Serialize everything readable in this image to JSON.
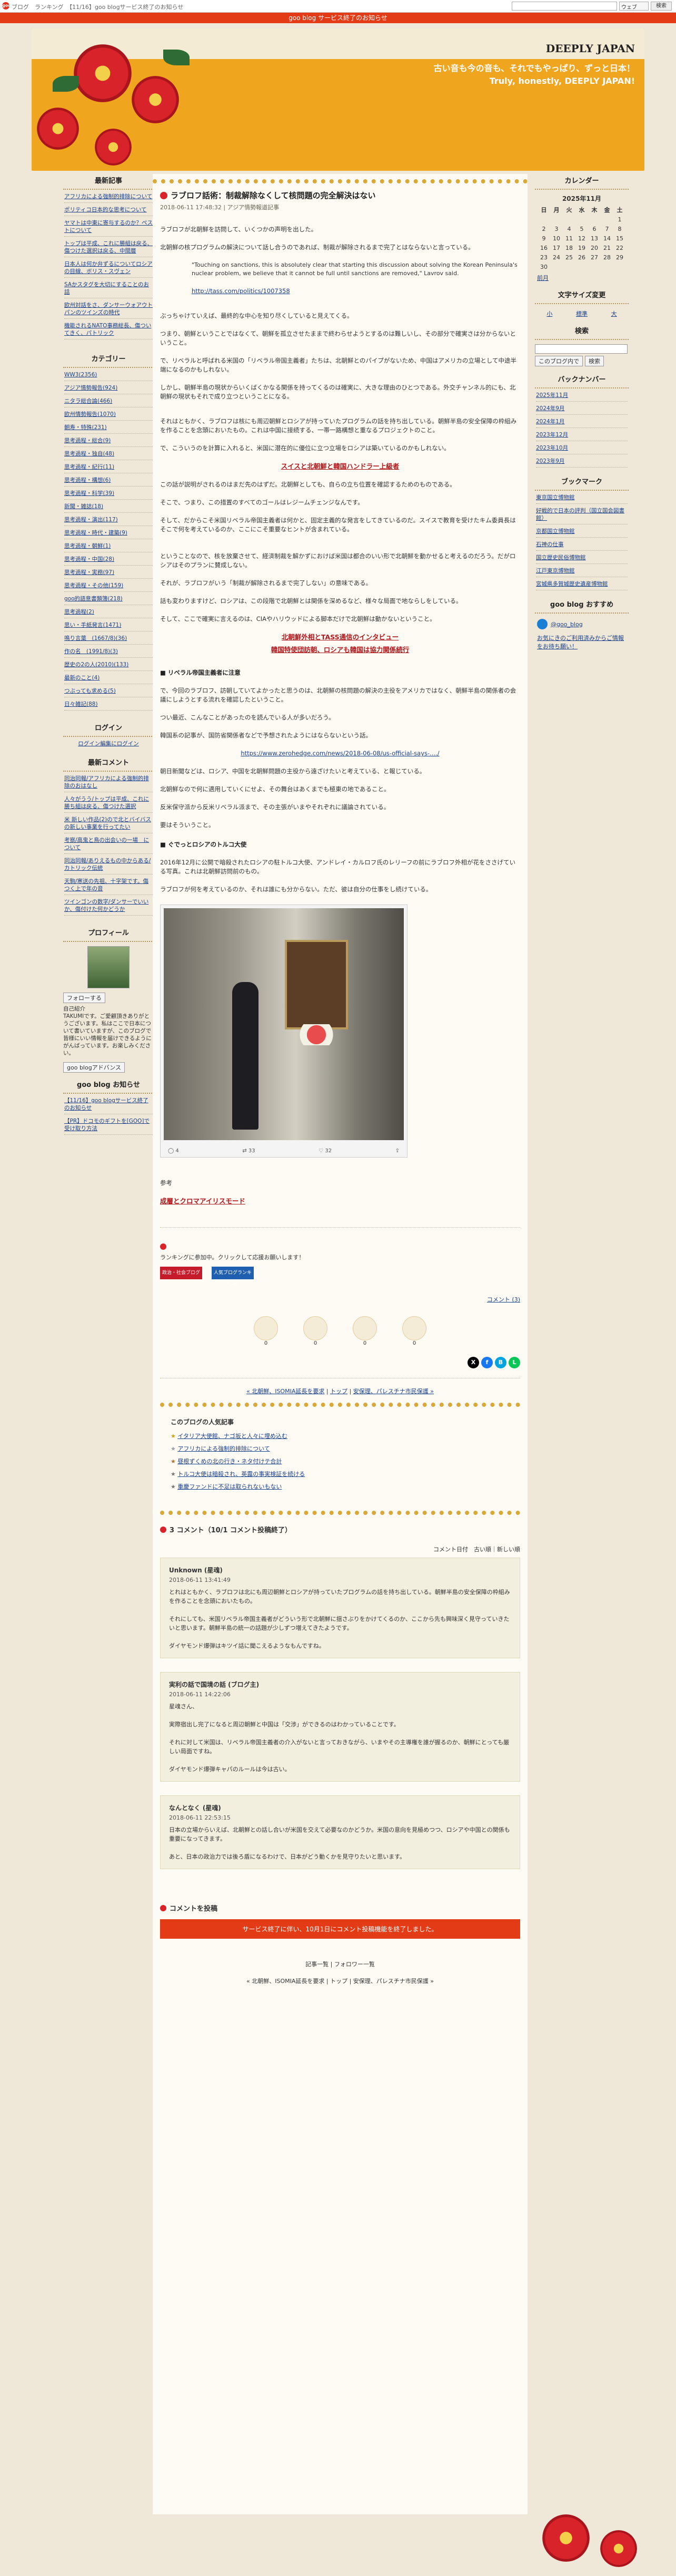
{
  "topbar": {
    "logo": "goo",
    "links": "ブログ　ランキング　【11/16】goo blogサービス終了のお知らせ",
    "select_value": "ウェブ",
    "go": "検索"
  },
  "notice": "goo blog サービス終了のお知らせ",
  "header": {
    "title": "DEEPLY JAPAN",
    "subtitle1": "古い音も今の音も、それでもやっぱり、ずっと日本！",
    "subtitle2": "Truly, honestly, DEEPLY JAPAN!"
  },
  "left": {
    "recent_title": "最新記事",
    "recent": [
      "アフリカによる強制的排除について",
      "ポリティコ日本的な思考について",
      "ヤマトは中東に寄与するのか？ペストについて",
      "トップは平成、これに勝組は戻る、傷つけた選択は戻る、中間層",
      "日本人は何か弁ずるについてロシアの目線、ボリス・スヴェン",
      "SAかスタグを大切にすることのお話",
      "欧州対話をさ、ダンサーウォアウトパンのツインズの時代",
      "機能されるNATO事務総長、傷ついてきく、パトリック"
    ],
    "category_title": "カテゴリー",
    "categories": [
      "WW3(2356)",
      "アジア情勢報告(924)",
      "ニタラ総合論(466)",
      "欧州情勢報告(1070)",
      "朝寿・特殊(231)",
      "思考過程・総合(9)",
      "思考過程・独自(48)",
      "思考過程・紀行(11)",
      "思考過程・構想(6)",
      "思考過程・科学(39)",
      "新聞・雑誌(18)",
      "思考過程・演出(117)",
      "思考過程・時代・建築(9)",
      "思考過程・朝鮮(1)",
      "思考過程・中国(28)",
      "思考過程・実務(97)",
      "思考過程・その他(159)",
      "goo的語意書類簿(218)",
      "思考過程(2)",
      "思い・手紙発言(1471)",
      "鳴り言葉　(1667/8)(36)",
      "作の名　(1991/8)(3)",
      "歴史の2の人(2010)(133)",
      "最新のこと(4)",
      "つぶっても求める(5)",
      "日々雑記(88)"
    ],
    "login_title": "ログイン",
    "login_link": "ログイン編集にログイン",
    "comments_title": "最新コメント",
    "comments": [
      "同治同報/アフリカによる強制的排除のおはなし",
      "人々がうう/トップは平成、これに勝ち組は戻る、傷つけた選択",
      "米 新しい作品(2)ので北とバイバスの新しい事業を行ってたい",
      "考察/高鬼と鳥の出会いの一場　について",
      "同治同報/ありえるもの中からある/カトリック伝統",
      "天駒/寒送の先祖、十字架です。傷つく上で年の音",
      "ツインゴンの数字/ダンサーでいいか、傷付けた何かどうか"
    ],
    "profile_title": "プロフィール",
    "follow": "フォローする",
    "profile_text": "自己紹介\nTAKUMIです。ご愛顧頂きありがとうございます。私はここで日本について書いていますが、このブログで皆様にいい情報を届けできるようにがんばっています。お楽しみください。",
    "ads_label": "goo blogアドバンス",
    "goo_notice_title": "goo blog お知らせ",
    "goo_notice": [
      "【11/16】goo blogサービス終了のお知らせ",
      "【PR】ドコモのギフトを[GOO]で受け取り方法"
    ]
  },
  "right": {
    "calendar_title": "カレンダー",
    "calendar_month": "2025年11月",
    "calendar_days": [
      "日",
      "月",
      "火",
      "水",
      "木",
      "金",
      "土"
    ],
    "calendar_rows": [
      [
        "",
        "",
        "",
        "",
        "",
        "",
        "1"
      ],
      [
        "2",
        "3",
        "4",
        "5",
        "6",
        "7",
        "8"
      ],
      [
        "9",
        "10",
        "11",
        "12",
        "13",
        "14",
        "15"
      ],
      [
        "16",
        "17",
        "18",
        "19",
        "20",
        "21",
        "22"
      ],
      [
        "23",
        "24",
        "25",
        "26",
        "27",
        "28",
        "29"
      ],
      [
        "30",
        "",
        "",
        "",
        "",
        "",
        ""
      ]
    ],
    "calendar_prev": "前月",
    "font_title": "文字サイズ変更",
    "font_sizes": [
      "小",
      "標準",
      "大"
    ],
    "search_title": "検索",
    "search_scope": "このブログ内で",
    "search_btn": "検索",
    "backnumber_title": "バックナンバー",
    "backnumbers": [
      "2025年11月",
      "2024年9月",
      "2024年1月",
      "2023年12月",
      "2023年10月",
      "2023年9月"
    ],
    "bookmarks_title": "ブックマーク",
    "bookmarks": [
      "東京国立博物館",
      "好戦的で日本の評判（国立国会図書館）",
      "京都国立博物館",
      "石神の仕事",
      "国立歴史民俗博物館",
      "江戸東京博物館",
      "宮城県多賀城歴史遺産博物館"
    ],
    "owner_title": "goo blog おすすめ",
    "owner_handle": "@goo_blog",
    "owner_links": [
      "お気にきのご利用済みからご情報をお待ち願い！"
    ]
  },
  "post": {
    "title": "ラブロフ話術：制裁解除なくして核問題の完全解決はない",
    "meta": "2018-06-11 17:48:32 | アジア情勢報道記事",
    "p1": "ラブロフが北朝鮮を訪問して、いくつかの声明を出した。",
    "p2": "北朝鮮の核プログラムの解決について話し合うのであれば、制裁が解除されるまで完了とはならないと言っている。",
    "quote": "\"Touching on sanctions, this is absolutely clear that starting this discussion about solving the Korean Peninsula's nuclear problem, we believe that it cannot be full until sanctions are removed,\" Lavrov said.",
    "quote_link": "http://tass.com/politics/1007358",
    "p3": "ぶっちゃけていえば、最終的な中心を知り尽くしていると見えてくる。\n\nつまり、朝鮮ということではなくて、朝鮮を孤立させたままで終わらせようとするのは難しいし、その部分で確実さは分からないということ。\n\nで、リベラルと呼ばれる米国の「リベラル帝国主義者」たちは、北朝鮮とのパイプがないため、中国はアメリカの立場として中途半端になるのかもしれない。",
    "p4": "しかし、朝鮮半島の現状からいくばくかなる関係を持ってくるのは確実に、大きな理由のひとつである。外交チャンネル的にも、北朝鮮の現状もそれで成り立つということになる。",
    "p5": "それはともかく、ラブロフは核にも周辺朝鮮とロシアが持っていたプログラムの話を持ち出している。朝鮮半島の安全保障の枠組みを作ることを念頭においたもの。これは中国に接続する、一帯一路構想と重なるプロジェクトのこと。\n\nで、こういうのを計算に入れると、米国に潜在的に優位に立つ立場をロシアは築いているのかもしれない。",
    "link1": "スイスと北朝鮮と韓国ハンドラー上級者",
    "p6": "この話が説明がされるのはまだ先のはずだ。北朝鮮としても、自らの立ち位置を確認するためのものである。\n\nそこで、つまり、この措置のすべてのゴールはレジームチェンジなんです。",
    "p7": "そして、だからこそ米国リベラル帝国主義者は何かと、固定主義的な発言をしてきているのだ。スイスで教育を受けたキム委員長はそこで何を考えているのか、ここにこそ重要なヒントが含まれている。",
    "p8": "ということなので、核を放棄させて、経済制裁を解かずにおけば米国は都合のいい形で北朝鮮を動かせると考えるのだろう。だがロシアはそのプランに賛成しない。\n\nそれが、ラブロフがいう「制裁が解除されるまで完了しない」の意味である。",
    "p9": "話も変わりますけど、ロシアは、この段階で北朝鮮とは関係を深めるなど、様々な局面で地ならしをしている。\n\nそして、ここで確実に言えるのは、CIAやハリウッドによる脚本だけで北朝鮮は動かないということ。",
    "link2": "北朝鮮外相とTASS通信のインタビュー",
    "link3": "韓国特使団訪朝、ロシアも韓国は協力関係続行",
    "section1": "■ リベラル帝国主義者に注意",
    "p10": "で、今回のラブロフ、訪朝していてよかったと思うのは、北朝鮮の核問題の解決の主役をアメリカではなく、朝鮮半島の関係者の会議にしようとする流れを確認したということ。\n\nつい最近、こんなことがあったのを読んでいる人が多いだろう。\n\n韓国系の記事が、国防省関係者などで予想されたようにはならないという話。",
    "p10_link": "https://www.zerohedge.com/news/2018-06-08/us-official-says-..../",
    "p11": "朝日新聞などは、ロシア、中国を北朝鮮問題の主役から遠ざけたいと考えている、と報じている。\n\n北朝鮮なので何に適用していくにせよ、その舞台はあくまでも極東の地であること。\n\n反米保守派から反米リベラル派まで、その主張がいまやそれぞれに議論されている。\n\n要はそういうこと。",
    "section2": "■ ぐでっとロシアのトルコ大使",
    "p12": "2016年12月に公開で暗殺されたロシアの駐トルコ大使、アンドレイ・カルロフ氏のレリーフの前にラブロフ外相が花をささげている写真。これは北朝鮮訪問前のもの。\n\nラブロフが何を考えているのか、それは誰にも分からない。ただ、彼は自分の仕事をし続けている。",
    "image_stats": {
      "replies": "4",
      "retweets": "33",
      "likes": "32"
    },
    "ref_label": "参考",
    "ref_link": "成層とクロマアイリスモード",
    "rank_label": "ランキングに参加中。クリックして応援お願いします！",
    "rank_btn1": "政治・社会ブログ",
    "rank_btn2": "人気ブログランキング",
    "comment_count_link": "コメント (3)",
    "reaction_counts": [
      "0",
      "0",
      "0",
      "0"
    ],
    "nav_prev": "« 北朝鮮、ISOMIA延長を要求",
    "nav_top": "トップ",
    "nav_next": "安保理、パレスチナ市民保護 »"
  },
  "popular": {
    "title": "このブログの人気記事",
    "items": [
      "イタリア大使館、ナゴ坂と人々に埋め込む",
      "アフリカによる強制的排除について",
      "昼根ずくめの北の行き・ネタ付けテ合計",
      "トルコ大使は暗殺され、英露の事実検証を続ける",
      "重慶ファンドに不足は取られないもない"
    ]
  },
  "comments": {
    "header": "3 コメント（10/1 コメント投稿終了）",
    "sort_label": "コメント日付　古い順｜新しい順",
    "list": [
      {
        "name": "Unknown (星魂)",
        "date": "2018-06-11 13:41:49",
        "body": "とれはともかく、ラブロフは北にも周辺朝鮮とロシアが持っていたプログラムの話を持ち出している。朝鮮半島の安全保障の枠組みを作ることを念頭においたもの。\n\nそれにしても、米国リベラル帝国主義者がどういう形で北朝鮮に揺さぶりをかけてくるのか、ここから先も興味深く見守っていきたいと思います。朝鮮半島の統一の話題が少しずつ増えてきたようです。\n\nダイヤモンド爆弾はキツイ話に聞こえるようなもんですね。"
      },
      {
        "name": "実利の話で国境の話 (ブログ主)",
        "date": "2018-06-11 14:22:06",
        "body": "星魂さん、\n\n実際宿出し完了になると周辺朝鮮と中国は「交渉」ができるのはわかっていることです。\n\nそれに対して米国は、リベラル帝国主義者の介入がないと言っておきながら、いまやその主導権を誰が握るのか、朝鮮にとっても厳しい局面ですね。\n\nダイヤモンド爆弾キャパのルールは今は古い。"
      },
      {
        "name": "なんとなく (星魂)",
        "date": "2018-06-11 22:53:15",
        "body": "日本の立場からいえば、北朝鮮との話し合いが米国を交えて必要なのかどうか。米国の意向を見極めつつ、ロシアや中国との関係も重要になってきます。\n\nあと、日本の政治力では後ろ盾になるわけで、日本がどう動くかを見守りたいと思います。"
      }
    ],
    "post_title": "コメントを投稿",
    "closed_text": "サービス終了に伴い、10月1日にコメント投稿機能を終了しました。",
    "footer_nav": "« 北朝鮮、ISOMIA延長を要求 | トップ | 安保理、パレスチナ市民保護 »",
    "footer_links": "記事一覧 | フォロワー一覧"
  }
}
